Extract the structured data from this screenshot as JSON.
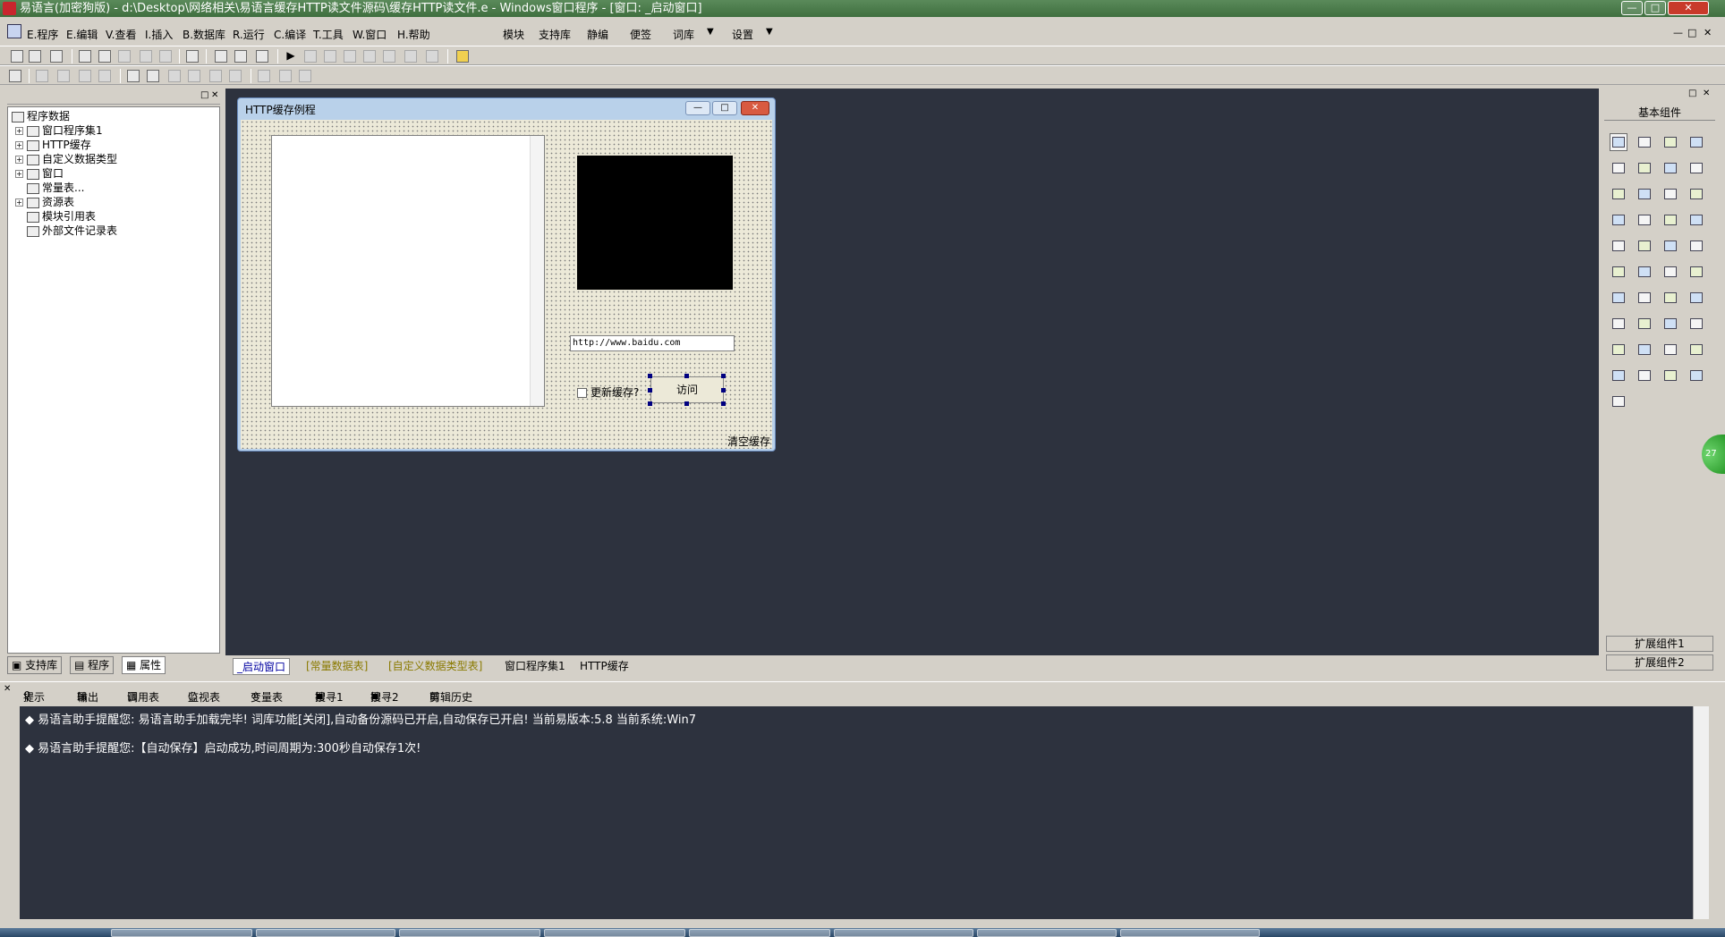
{
  "window": {
    "title": "易语言(加密狗版) - d:\\Desktop\\网络相关\\易语言缓存HTTP读文件源码\\缓存HTTP读文件.e - Windows窗口程序 - [窗口: _启动窗口]",
    "min_glyph": "—",
    "max_glyph": "□",
    "close_glyph": "✕"
  },
  "menu": {
    "items": [
      "E.程序",
      "E.编辑",
      "V.查看",
      "I.插入",
      "B.数据库",
      "R.运行",
      "C.编译",
      "T.工具",
      "W.窗口",
      "H.帮助"
    ],
    "extras": [
      "模块",
      "支持库",
      "静编",
      "便签",
      "词库",
      "设置"
    ],
    "extras_arrow": "▼"
  },
  "tree": {
    "items": [
      {
        "label": "程序数据",
        "expander": ""
      },
      {
        "label": "窗口程序集1",
        "expander": "+"
      },
      {
        "label": "HTTP缓存",
        "expander": "+"
      },
      {
        "label": "自定义数据类型",
        "expander": "+"
      },
      {
        "label": "窗口",
        "expander": "+"
      },
      {
        "label": "常量表...",
        "expander": ""
      },
      {
        "label": "资源表",
        "expander": "+"
      },
      {
        "label": "模块引用表",
        "expander": ""
      },
      {
        "label": "外部文件记录表",
        "expander": ""
      }
    ]
  },
  "left_tabs": [
    "支持库",
    "程序",
    "属性"
  ],
  "form": {
    "title": "HTTP缓存例程",
    "url_value": "http://www.baidu.com",
    "checkbox_label": "更新缓存?",
    "visit_button": "访问",
    "clear_label": "清空缓存"
  },
  "right_panel": {
    "title": "基本组件",
    "ext_tabs": [
      "扩展组件1",
      "扩展组件2"
    ],
    "tools": [
      "pointer",
      "label",
      "picture",
      "shape",
      "edit",
      "frame",
      "text",
      "line",
      "check",
      "radio",
      "list",
      "grid",
      "table",
      "spin",
      "scroll",
      "ruler",
      "hline",
      "vline",
      "tree",
      "dialog",
      "calendar",
      "input",
      "folder",
      "doc",
      "timer",
      "drive",
      "print",
      "file",
      "clock",
      "media",
      "net",
      "link",
      "frame2",
      "tab",
      "image",
      "panel",
      "db",
      "odbc",
      "chart",
      "odbc2",
      "odbc3"
    ]
  },
  "design_tabs": [
    "_启动窗口",
    "[常量数据表]",
    "[自定义数据类型表]",
    "窗口程序集1",
    "HTTP缓存"
  ],
  "output_tabs": [
    "提示",
    "输出",
    "调用表",
    "监视表",
    "变量表",
    "搜寻1",
    "搜寻2",
    "剪辑历史"
  ],
  "output": {
    "bullet": "◆",
    "lines": [
      "易语言助手提醒您:  易语言助手加载完毕!  词库功能[关闭],自动备份源码已开启,自动保存已开启!  当前易版本:5.8  当前系统:Win7",
      "易语言助手提醒您:【自动保存】启动成功,时间周期为:300秒自动保存1次!"
    ]
  },
  "badge": "27",
  "colors": {
    "design_bg": "#2d323e",
    "title_green": "#4a7a4a",
    "form_frame": "#b9d1ea"
  }
}
